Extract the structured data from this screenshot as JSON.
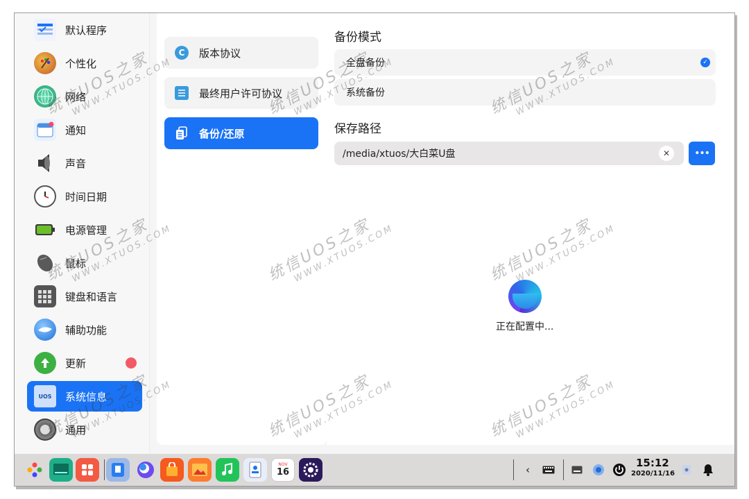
{
  "sidebar": {
    "items": [
      {
        "label": "默认程序",
        "icon": "default-apps-icon",
        "color": "#3b82f6"
      },
      {
        "label": "个性化",
        "icon": "palette-icon",
        "color": "#b45a2a"
      },
      {
        "label": "网络",
        "icon": "network-globe-icon",
        "color": "#2bb673"
      },
      {
        "label": "通知",
        "icon": "notification-icon",
        "color": "#4a90e2"
      },
      {
        "label": "声音",
        "icon": "speaker-icon",
        "color": "#555555"
      },
      {
        "label": "时间日期",
        "icon": "clock-icon",
        "color": "#666666"
      },
      {
        "label": "电源管理",
        "icon": "battery-icon",
        "color": "#6cbf2a"
      },
      {
        "label": "鼠标",
        "icon": "mouse-icon",
        "color": "#555555"
      },
      {
        "label": "键盘和语言",
        "icon": "keyboard-icon",
        "color": "#777777"
      },
      {
        "label": "辅助功能",
        "icon": "accessibility-icon",
        "color": "#2a82e0"
      },
      {
        "label": "更新",
        "icon": "update-arrow-icon",
        "color": "#3cb043"
      },
      {
        "label": "系统信息",
        "icon": "system-info-icon",
        "color": "#1a73f5"
      },
      {
        "label": "通用",
        "icon": "gear-icon",
        "color": "#666666"
      }
    ],
    "active_index": 11
  },
  "middle": {
    "items": [
      {
        "label": "版本协议",
        "icon": "copyright-icon"
      },
      {
        "label": "最终用户许可协议",
        "icon": "document-list-icon"
      },
      {
        "label": "备份/还原",
        "icon": "backup-icon"
      }
    ],
    "active_index": 2
  },
  "content": {
    "backup_mode_title": "备份模式",
    "options": [
      {
        "label": "全盘备份",
        "checked": true
      },
      {
        "label": "系统备份",
        "checked": false
      }
    ],
    "save_path_title": "保存路径",
    "save_path_value": "/media/xtuos/大白菜U盘",
    "browse_label": "•••",
    "clear_label": "✕",
    "status_text": "正在配置中..."
  },
  "taskbar": {
    "apps": [
      "launcher-icon",
      "desktop-icon",
      "multitask-icon",
      "file-manager-icon",
      "browser-icon",
      "app-store-icon",
      "image-viewer-icon",
      "music-icon",
      "contacts-icon",
      "calendar-icon",
      "control-center-icon"
    ],
    "tray": {
      "time": "15:12",
      "date": "2020/11/16",
      "calendar_month": "NOV",
      "calendar_day": "16"
    }
  },
  "watermark": {
    "text": "统信UOS之家",
    "url": "WWW.XTUOS.COM"
  },
  "colors": {
    "accent": "#1a73f5",
    "badge_red": "#f25a67"
  }
}
